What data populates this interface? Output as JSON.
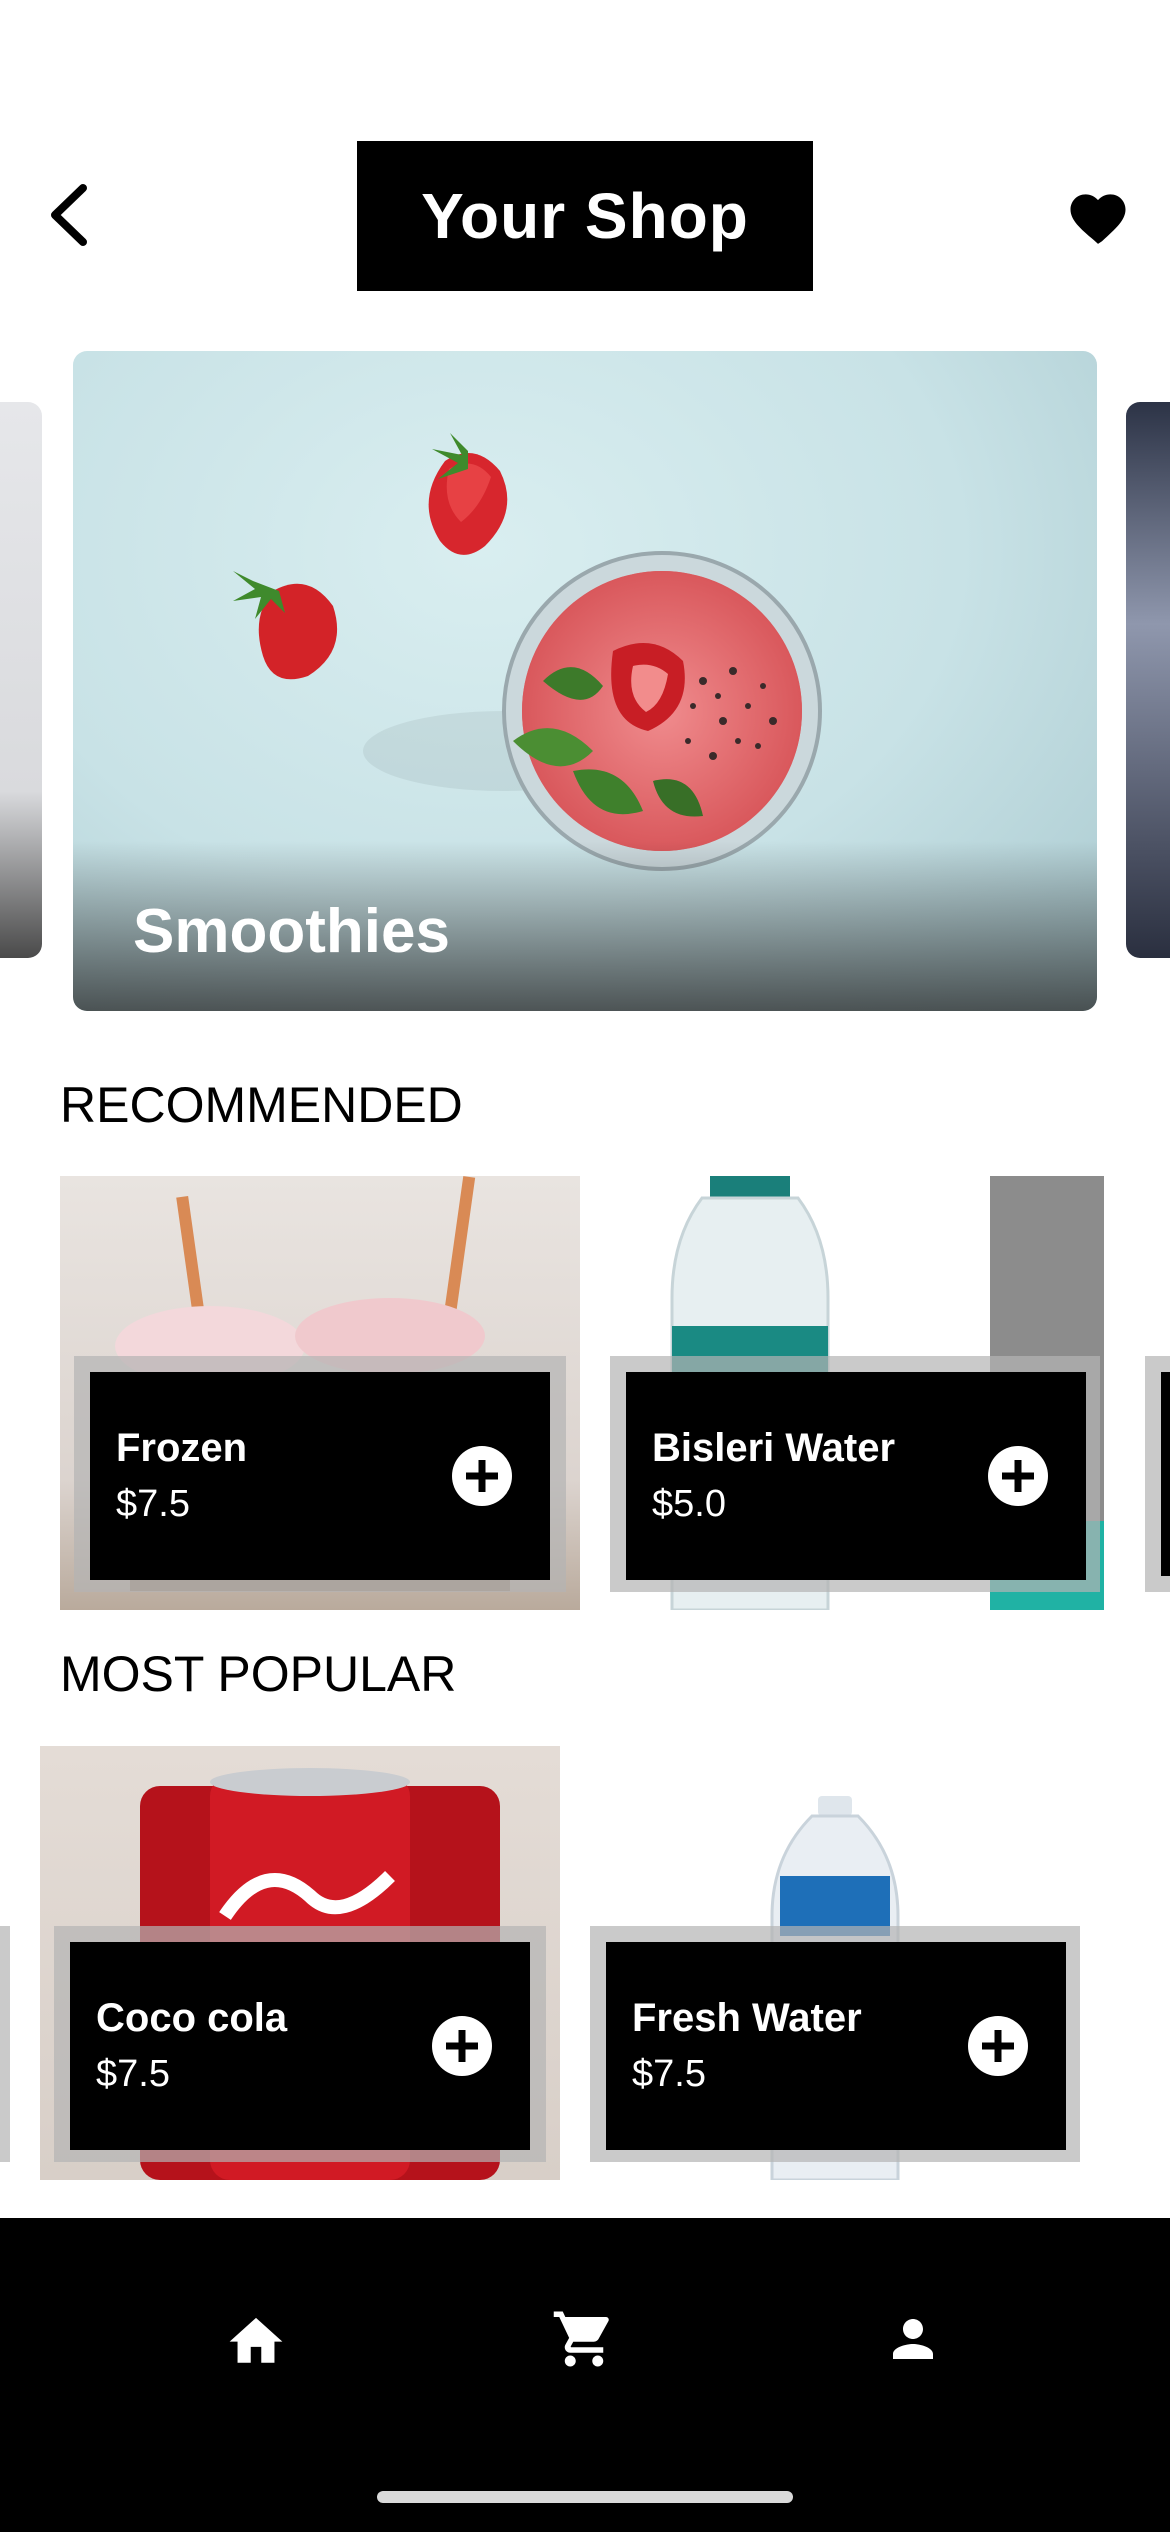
{
  "header": {
    "title": "Your Shop",
    "back_icon": "chevron-left-icon",
    "favorite_icon": "heart-icon"
  },
  "hero": {
    "items": [
      {
        "label": "Smoothies"
      }
    ]
  },
  "recommended": {
    "title": "RECOMMENDED",
    "items": [
      {
        "name": "Frozen",
        "price": "$7.5"
      },
      {
        "name": "Bisleri Water",
        "price": "$5.0"
      }
    ]
  },
  "popular": {
    "title": "MOST POPULAR",
    "items": [
      {
        "name": "Coco cola",
        "price": "$7.5"
      },
      {
        "name": "Fresh Water",
        "price": "$7.5"
      }
    ]
  },
  "bottom_nav": {
    "items": [
      {
        "icon": "home-icon"
      },
      {
        "icon": "cart-icon"
      },
      {
        "icon": "profile-icon"
      }
    ]
  },
  "colors": {
    "primary": "#000000",
    "background": "#ffffff",
    "on_primary": "#ffffff"
  }
}
